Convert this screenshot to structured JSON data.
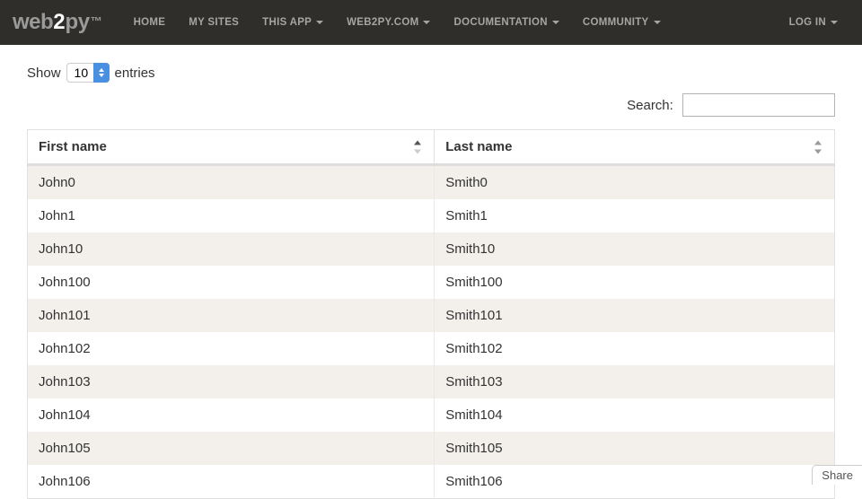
{
  "navbar": {
    "brand": {
      "w": "web",
      "n": "2",
      "py": "py",
      "tm": "™"
    },
    "items": [
      {
        "label": "HOME",
        "dropdown": false
      },
      {
        "label": "MY SITES",
        "dropdown": false
      },
      {
        "label": "THIS APP",
        "dropdown": true
      },
      {
        "label": "WEB2PY.COM",
        "dropdown": true
      },
      {
        "label": "DOCUMENTATION",
        "dropdown": true
      },
      {
        "label": "COMMUNITY",
        "dropdown": true
      }
    ],
    "right": [
      {
        "label": "LOG IN",
        "dropdown": true
      }
    ]
  },
  "length": {
    "prefix": "Show",
    "value": "10",
    "suffix": "entries"
  },
  "search": {
    "label": "Search:",
    "value": ""
  },
  "columns": [
    {
      "label": "First name",
      "sort": "asc"
    },
    {
      "label": "Last name",
      "sort": "both"
    }
  ],
  "rows": [
    {
      "first": "John0",
      "last": "Smith0"
    },
    {
      "first": "John1",
      "last": "Smith1"
    },
    {
      "first": "John10",
      "last": "Smith10"
    },
    {
      "first": "John100",
      "last": "Smith100"
    },
    {
      "first": "John101",
      "last": "Smith101"
    },
    {
      "first": "John102",
      "last": "Smith102"
    },
    {
      "first": "John103",
      "last": "Smith103"
    },
    {
      "first": "John104",
      "last": "Smith104"
    },
    {
      "first": "John105",
      "last": "Smith105"
    },
    {
      "first": "John106",
      "last": "Smith106"
    }
  ],
  "share": {
    "label": "Share"
  }
}
